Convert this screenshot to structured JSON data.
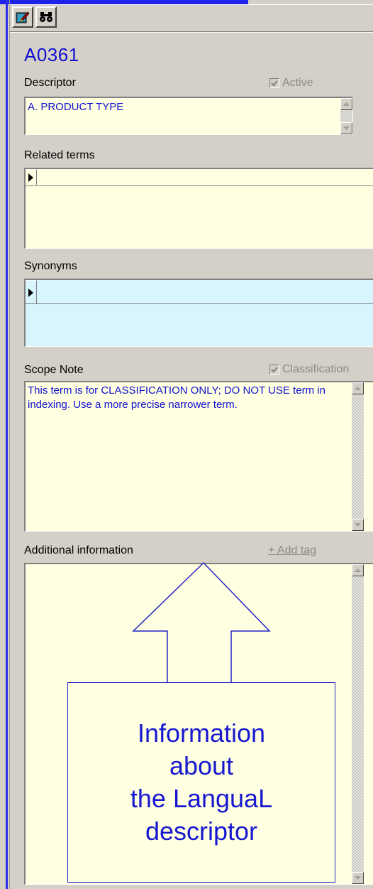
{
  "toolbar": {
    "buttons": [
      {
        "icon": "edit-record-icon"
      },
      {
        "icon": "binoculars-icon"
      }
    ]
  },
  "record": {
    "code": "A0361",
    "descriptor_label": "Descriptor",
    "active_label": "Active",
    "active_checked": true,
    "descriptor_value": "A. PRODUCT TYPE",
    "related_terms_label": "Related terms",
    "synonyms_label": "Synonyms",
    "scope_note_label": "Scope Note",
    "classification_label": "Classification",
    "classification_checked": true,
    "scope_note_value": "This term is for CLASSIFICATION ONLY; DO NOT USE term in indexing. Use a more precise narrower term.",
    "additional_info_label": "Additional information",
    "add_tag_label": "+ Add tag"
  },
  "callout": {
    "lines": [
      "Information",
      "about",
      "the LanguaL",
      "descriptor"
    ]
  },
  "colors": {
    "field_yellow": "#ffffe1",
    "synonyms_blue": "#d8f4fc",
    "code_blue": "#1010d0",
    "accent_bar": "#1e22e8"
  }
}
